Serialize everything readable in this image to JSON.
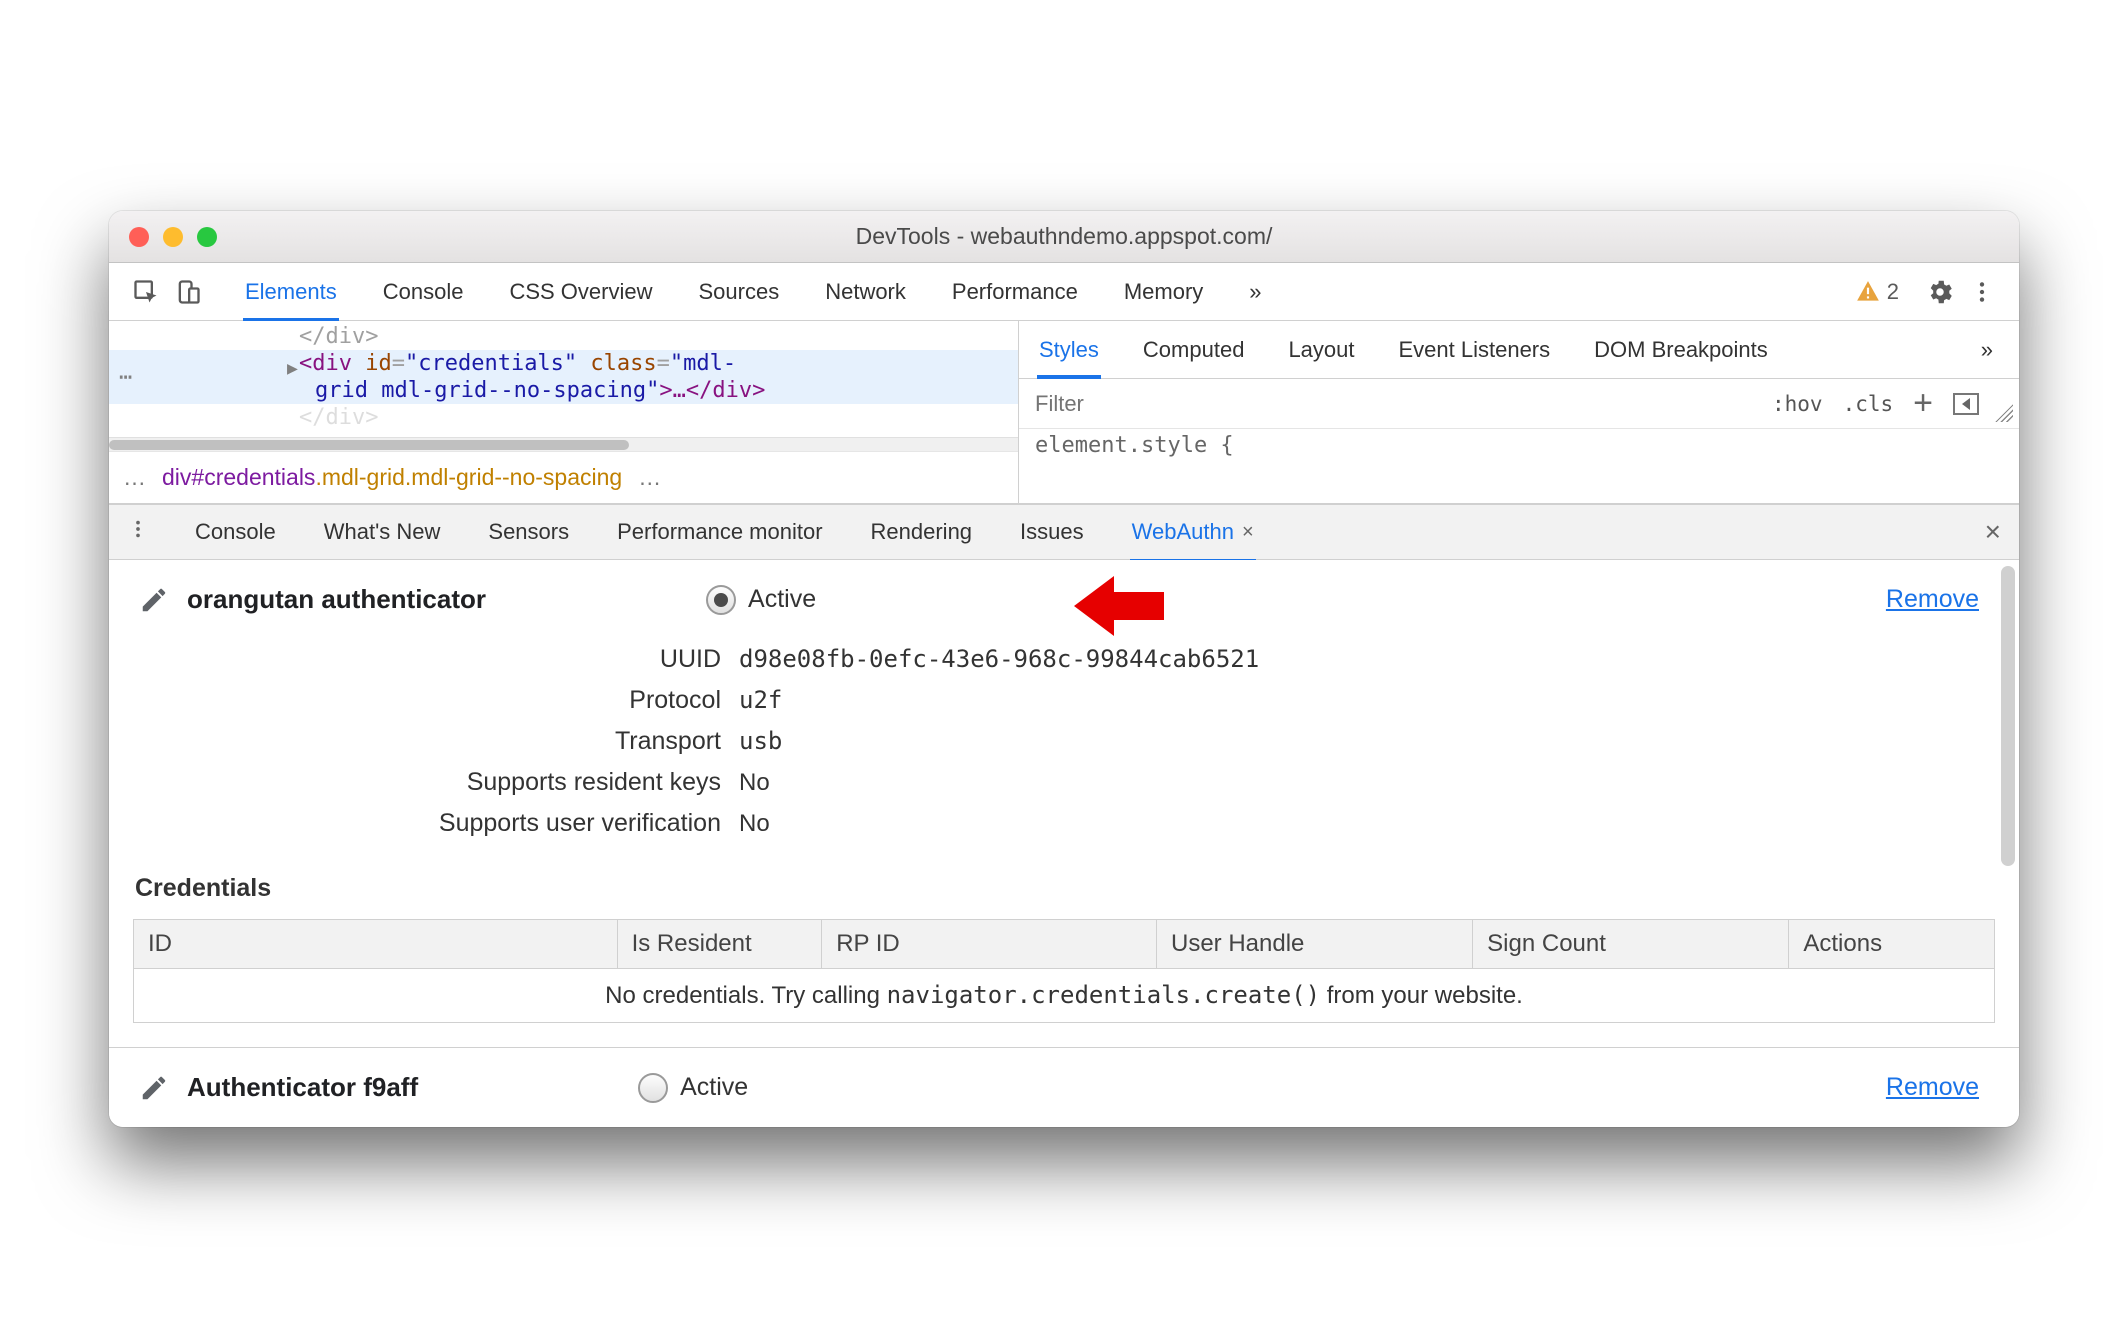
{
  "titlebar": {
    "title": "DevTools - webauthndemo.appspot.com/"
  },
  "tabs": {
    "items": [
      "Elements",
      "Console",
      "CSS Overview",
      "Sources",
      "Network",
      "Performance",
      "Memory"
    ],
    "more": "»",
    "warning_count": "2"
  },
  "elements_pane": {
    "dom_lines": {
      "line0": {
        "close_div": "</div>"
      },
      "line1": {
        "open": "<div",
        "id_attr": "id",
        "id_val": "\"credentials\"",
        "class_attr": "class",
        "class_val_a": "\"mdl-",
        "class_val_b": "grid mdl-grid--no-spacing\"",
        "mid": ">…</div>"
      },
      "line2": {
        "partial": "</div>"
      }
    },
    "breadcrumb": {
      "ell_left": "…",
      "seg_el": "div",
      "seg_id": "#credentials",
      "seg_class": ".mdl-grid.mdl-grid--no-spacing",
      "ell_right": "…"
    }
  },
  "styles_pane": {
    "tabs": [
      "Styles",
      "Computed",
      "Layout",
      "Event Listeners",
      "DOM Breakpoints"
    ],
    "more": "»",
    "filter_placeholder": "Filter",
    "hov": ":hov",
    "cls": ".cls",
    "plus": "+",
    "element_style": "element.style {"
  },
  "drawer": {
    "tabs": [
      "Console",
      "What's New",
      "Sensors",
      "Performance monitor",
      "Rendering",
      "Issues",
      "WebAuthn"
    ],
    "active_close": "×",
    "close": "×"
  },
  "webauthn": {
    "authenticators": [
      {
        "name": "orangutan authenticator",
        "active": true,
        "active_label": "Active",
        "remove_label": "Remove",
        "fields": {
          "uuid_label": "UUID",
          "uuid": "d98e08fb-0efc-43e6-968c-99844cab6521",
          "protocol_label": "Protocol",
          "protocol": "u2f",
          "transport_label": "Transport",
          "transport": "usb",
          "srk_label": "Supports resident keys",
          "srk": "No",
          "suv_label": "Supports user verification",
          "suv": "No"
        }
      },
      {
        "name": "Authenticator f9aff",
        "active": false,
        "active_label": "Active",
        "remove_label": "Remove"
      }
    ],
    "credentials_heading": "Credentials",
    "credentials_columns": {
      "id": "ID",
      "is_resident": "Is Resident",
      "rp_id": "RP ID",
      "user_handle": "User Handle",
      "sign_count": "Sign Count",
      "actions": "Actions"
    },
    "credentials_empty_prefix": "No credentials. Try calling ",
    "credentials_empty_code": "navigator.credentials.create()",
    "credentials_empty_suffix": " from your website."
  }
}
